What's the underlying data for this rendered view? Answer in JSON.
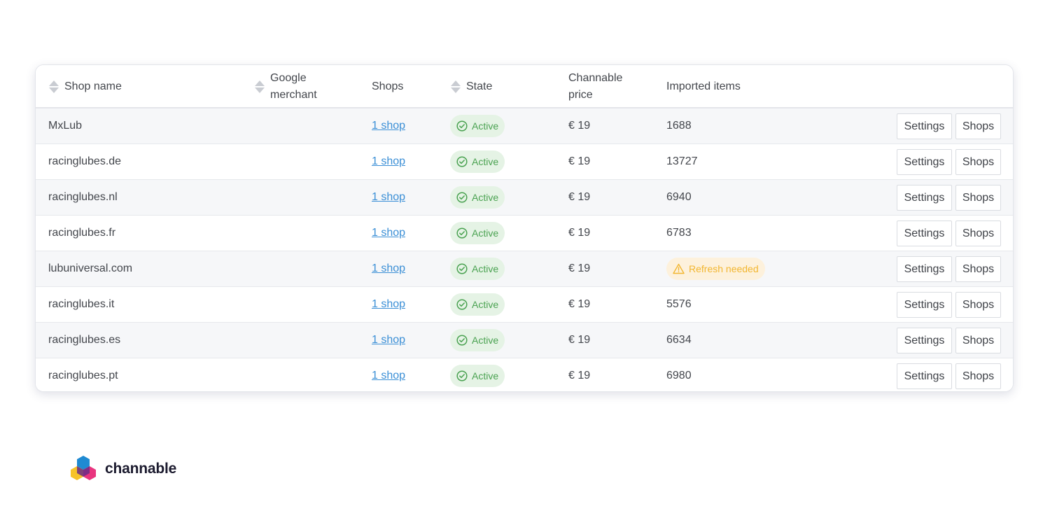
{
  "table": {
    "columns": {
      "shop_name": "Shop name",
      "google_merchant_1": "Google",
      "google_merchant_2": "merchant",
      "shops": "Shops",
      "state": "State",
      "channable_price_1": "Channable",
      "channable_price_2": "price",
      "imported_items": "Imported items"
    },
    "rows": [
      {
        "name": "MxLub",
        "shops_link": "1 shop",
        "state": "Active",
        "price": "€ 19",
        "imported": "1688",
        "settings": "Settings",
        "shops_btn": "Shops"
      },
      {
        "name": "racinglubes.de",
        "shops_link": "1 shop",
        "state": "Active",
        "price": "€ 19",
        "imported": "13727",
        "settings": "Settings",
        "shops_btn": "Shops"
      },
      {
        "name": "racinglubes.nl",
        "shops_link": "1 shop",
        "state": "Active",
        "price": "€ 19",
        "imported": "6940",
        "settings": "Settings",
        "shops_btn": "Shops"
      },
      {
        "name": "racinglubes.fr",
        "shops_link": "1 shop",
        "state": "Active",
        "price": "€ 19",
        "imported": "6783",
        "settings": "Settings",
        "shops_btn": "Shops"
      },
      {
        "name": "lubuniversal.com",
        "shops_link": "1 shop",
        "state": "Active",
        "price": "€ 19",
        "imported_warning": "Refresh needed",
        "settings": "Settings",
        "shops_btn": "Shops"
      },
      {
        "name": "racinglubes.it",
        "shops_link": "1 shop",
        "state": "Active",
        "price": "€ 19",
        "imported": "5576",
        "settings": "Settings",
        "shops_btn": "Shops"
      },
      {
        "name": "racinglubes.es",
        "shops_link": "1 shop",
        "state": "Active",
        "price": "€ 19",
        "imported": "6634",
        "settings": "Settings",
        "shops_btn": "Shops"
      },
      {
        "name": "racinglubes.pt",
        "shops_link": "1 shop",
        "state": "Active",
        "price": "€ 19",
        "imported": "6980",
        "settings": "Settings",
        "shops_btn": "Shops"
      }
    ]
  },
  "brand": {
    "name": "channable",
    "colors": {
      "blue": "#1f8ad2",
      "yellow": "#f7c32a",
      "pink": "#e9357f",
      "purple": "#6a2c86"
    }
  },
  "colors": {
    "active_text": "#4aa251",
    "active_bg": "#e5f3e5",
    "warning_text": "#f2b630",
    "warning_bg": "#fdf1dc",
    "link": "#3b8fd6"
  },
  "icons": {
    "sort": "sort-icon",
    "active": "check-circle-icon",
    "warning": "warning-triangle-icon"
  }
}
